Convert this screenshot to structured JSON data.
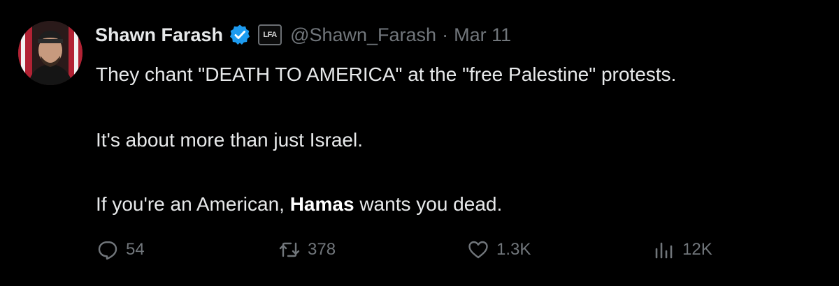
{
  "author": {
    "display_name": "Shawn Farash",
    "verified": true,
    "affiliation_badge": "LFA",
    "handle": "@Shawn_Farash",
    "separator": "·",
    "date": "Mar 11"
  },
  "tweet": {
    "line1": "They chant \"DEATH TO AMERICA\" at the \"free Palestine\" protests.",
    "line2": "It's about more than just Israel.",
    "line3_before": "If you're an American, ",
    "line3_bold": "Hamas",
    "line3_after": " wants you dead."
  },
  "actions": {
    "replies": "54",
    "retweets": "378",
    "likes": "1.3K",
    "views": "12K"
  },
  "colors": {
    "background": "#000000",
    "text": "#e7e9ea",
    "muted": "#71767b",
    "verified_blue": "#1d9bf0"
  }
}
